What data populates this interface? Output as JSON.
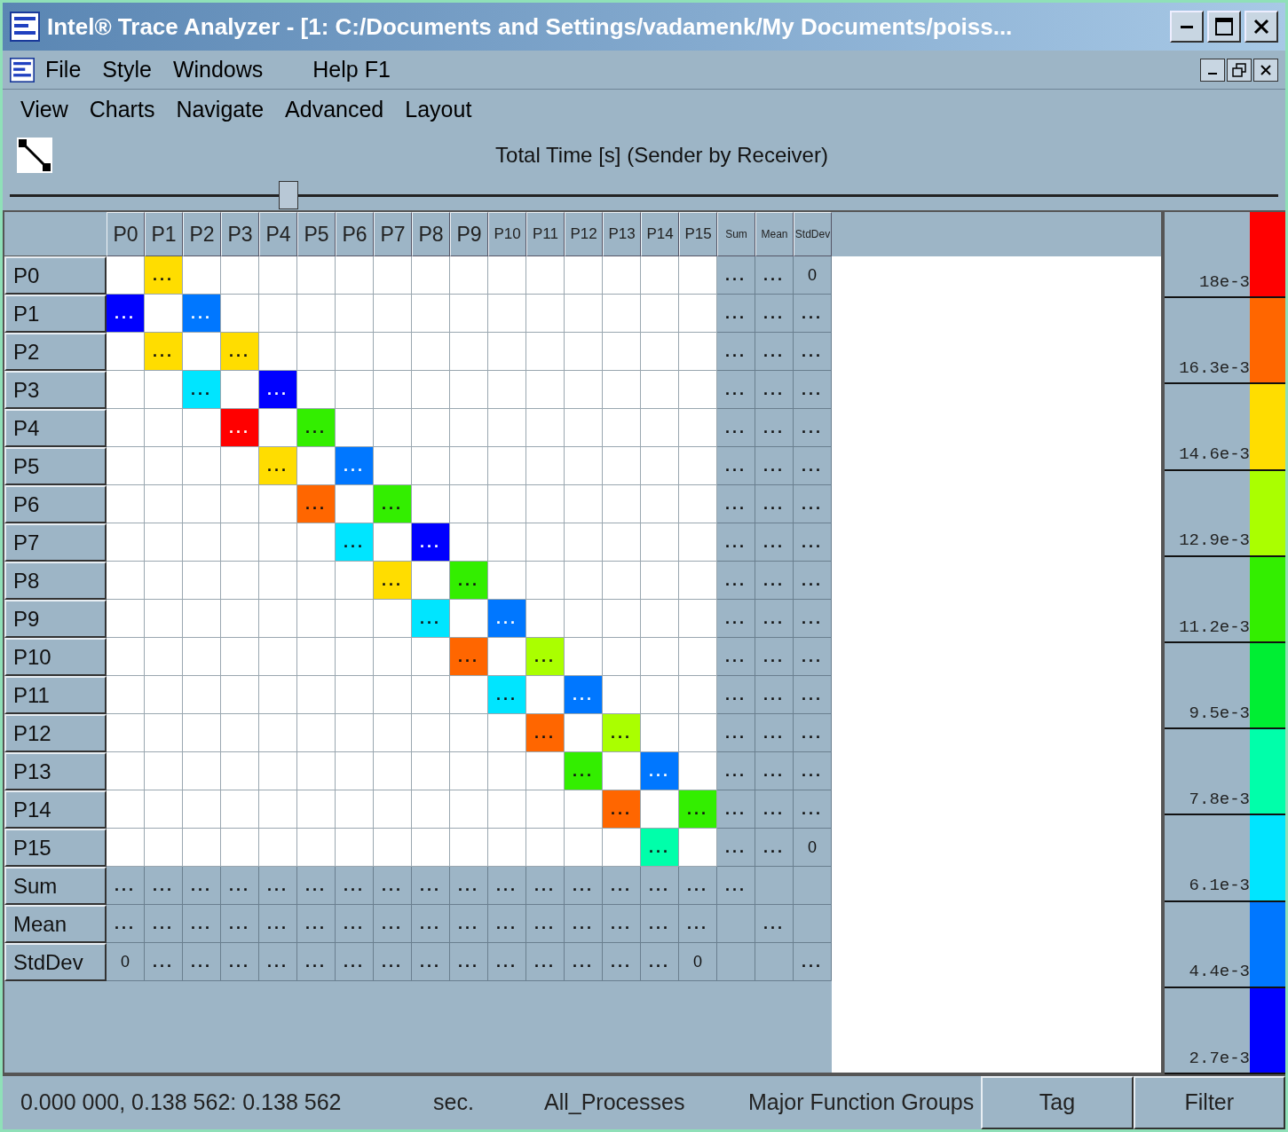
{
  "window": {
    "title": "Intel® Trace Analyzer - [1: C:/Documents and Settings/vadamenk/My Documents/poiss..."
  },
  "menu_bar": [
    "File",
    "Style",
    "Windows",
    "Help F1"
  ],
  "chart_menu": [
    "View",
    "Charts",
    "Navigate",
    "Advanced",
    "Layout"
  ],
  "chart_title": "Total Time [s] (Sender by Receiver)",
  "slider": {
    "level": 0.22
  },
  "matrix": {
    "columns": [
      {
        "label": "P0",
        "kind": "process"
      },
      {
        "label": "P1",
        "kind": "process"
      },
      {
        "label": "P2",
        "kind": "process"
      },
      {
        "label": "P3",
        "kind": "process"
      },
      {
        "label": "P4",
        "kind": "process"
      },
      {
        "label": "P5",
        "kind": "process"
      },
      {
        "label": "P6",
        "kind": "process"
      },
      {
        "label": "P7",
        "kind": "process"
      },
      {
        "label": "P8",
        "kind": "process"
      },
      {
        "label": "P9",
        "kind": "process"
      },
      {
        "label": "P10",
        "kind": "process"
      },
      {
        "label": "P11",
        "kind": "process"
      },
      {
        "label": "P12",
        "kind": "process"
      },
      {
        "label": "P13",
        "kind": "process"
      },
      {
        "label": "P14",
        "kind": "process"
      },
      {
        "label": "P15",
        "kind": "process"
      },
      {
        "label": "Sum",
        "kind": "statistic"
      },
      {
        "label": "Mean",
        "kind": "statistic"
      },
      {
        "label": "StdDev",
        "kind": "statistic"
      }
    ],
    "rows": [
      {
        "label": "P0",
        "kind": "process",
        "cells": [
          {},
          {
            "text": "...",
            "color": "#ffdd00"
          },
          {},
          {},
          {},
          {},
          {},
          {},
          {},
          {},
          {},
          {},
          {},
          {},
          {},
          {},
          {
            "text": "..."
          },
          {
            "text": "..."
          },
          {
            "text": "0"
          }
        ]
      },
      {
        "label": "P1",
        "kind": "process",
        "cells": [
          {
            "text": "...",
            "color": "#0000ff"
          },
          {},
          {
            "text": "...",
            "color": "#0077ff"
          },
          {},
          {},
          {},
          {},
          {},
          {},
          {},
          {},
          {},
          {},
          {},
          {},
          {},
          {
            "text": "..."
          },
          {
            "text": "..."
          },
          {
            "text": "..."
          }
        ]
      },
      {
        "label": "P2",
        "kind": "process",
        "cells": [
          {},
          {
            "text": "...",
            "color": "#ffdd00"
          },
          {},
          {
            "text": "...",
            "color": "#ffdd00"
          },
          {},
          {},
          {},
          {},
          {},
          {},
          {},
          {},
          {},
          {},
          {},
          {},
          {
            "text": "..."
          },
          {
            "text": "..."
          },
          {
            "text": "..."
          }
        ]
      },
      {
        "label": "P3",
        "kind": "process",
        "cells": [
          {},
          {},
          {
            "text": "...",
            "color": "#00e5ff"
          },
          {},
          {
            "text": "...",
            "color": "#0000ff"
          },
          {},
          {},
          {},
          {},
          {},
          {},
          {},
          {},
          {},
          {},
          {},
          {
            "text": "..."
          },
          {
            "text": "..."
          },
          {
            "text": "..."
          }
        ]
      },
      {
        "label": "P4",
        "kind": "process",
        "cells": [
          {},
          {},
          {},
          {
            "text": "...",
            "color": "#ff0000"
          },
          {},
          {
            "text": "...",
            "color": "#33ee00"
          },
          {},
          {},
          {},
          {},
          {},
          {},
          {},
          {},
          {},
          {},
          {
            "text": "..."
          },
          {
            "text": "..."
          },
          {
            "text": "..."
          }
        ]
      },
      {
        "label": "P5",
        "kind": "process",
        "cells": [
          {},
          {},
          {},
          {},
          {
            "text": "...",
            "color": "#ffdd00"
          },
          {},
          {
            "text": "...",
            "color": "#0077ff"
          },
          {},
          {},
          {},
          {},
          {},
          {},
          {},
          {},
          {},
          {
            "text": "..."
          },
          {
            "text": "..."
          },
          {
            "text": "..."
          }
        ]
      },
      {
        "label": "P6",
        "kind": "process",
        "cells": [
          {},
          {},
          {},
          {},
          {},
          {
            "text": "...",
            "color": "#ff6600"
          },
          {},
          {
            "text": "...",
            "color": "#33ee00"
          },
          {},
          {},
          {},
          {},
          {},
          {},
          {},
          {},
          {
            "text": "..."
          },
          {
            "text": "..."
          },
          {
            "text": "..."
          }
        ]
      },
      {
        "label": "P7",
        "kind": "process",
        "cells": [
          {},
          {},
          {},
          {},
          {},
          {},
          {
            "text": "...",
            "color": "#00e5ff"
          },
          {},
          {
            "text": "...",
            "color": "#0000ff"
          },
          {},
          {},
          {},
          {},
          {},
          {},
          {},
          {
            "text": "..."
          },
          {
            "text": "..."
          },
          {
            "text": "..."
          }
        ]
      },
      {
        "label": "P8",
        "kind": "process",
        "cells": [
          {},
          {},
          {},
          {},
          {},
          {},
          {},
          {
            "text": "...",
            "color": "#ffdd00"
          },
          {},
          {
            "text": "...",
            "color": "#33ee00"
          },
          {},
          {},
          {},
          {},
          {},
          {},
          {
            "text": "..."
          },
          {
            "text": "..."
          },
          {
            "text": "..."
          }
        ]
      },
      {
        "label": "P9",
        "kind": "process",
        "cells": [
          {},
          {},
          {},
          {},
          {},
          {},
          {},
          {},
          {
            "text": "...",
            "color": "#00e5ff"
          },
          {},
          {
            "text": "...",
            "color": "#0077ff"
          },
          {},
          {},
          {},
          {},
          {},
          {
            "text": "..."
          },
          {
            "text": "..."
          },
          {
            "text": "..."
          }
        ]
      },
      {
        "label": "P10",
        "kind": "process",
        "cells": [
          {},
          {},
          {},
          {},
          {},
          {},
          {},
          {},
          {},
          {
            "text": "...",
            "color": "#ff6600"
          },
          {},
          {
            "text": "...",
            "color": "#aaff00"
          },
          {},
          {},
          {},
          {},
          {
            "text": "..."
          },
          {
            "text": "..."
          },
          {
            "text": "..."
          }
        ]
      },
      {
        "label": "P11",
        "kind": "process",
        "cells": [
          {},
          {},
          {},
          {},
          {},
          {},
          {},
          {},
          {},
          {},
          {
            "text": "...",
            "color": "#00e5ff"
          },
          {},
          {
            "text": "...",
            "color": "#0077ff"
          },
          {},
          {},
          {},
          {
            "text": "..."
          },
          {
            "text": "..."
          },
          {
            "text": "..."
          }
        ]
      },
      {
        "label": "P12",
        "kind": "process",
        "cells": [
          {},
          {},
          {},
          {},
          {},
          {},
          {},
          {},
          {},
          {},
          {},
          {
            "text": "...",
            "color": "#ff6600"
          },
          {},
          {
            "text": "...",
            "color": "#aaff00"
          },
          {},
          {},
          {
            "text": "..."
          },
          {
            "text": "..."
          },
          {
            "text": "..."
          }
        ]
      },
      {
        "label": "P13",
        "kind": "process",
        "cells": [
          {},
          {},
          {},
          {},
          {},
          {},
          {},
          {},
          {},
          {},
          {},
          {},
          {
            "text": "...",
            "color": "#33ee00"
          },
          {},
          {
            "text": "...",
            "color": "#0077ff"
          },
          {},
          {
            "text": "..."
          },
          {
            "text": "..."
          },
          {
            "text": "..."
          }
        ]
      },
      {
        "label": "P14",
        "kind": "process",
        "cells": [
          {},
          {},
          {},
          {},
          {},
          {},
          {},
          {},
          {},
          {},
          {},
          {},
          {},
          {
            "text": "...",
            "color": "#ff6600"
          },
          {},
          {
            "text": "...",
            "color": "#33ee00"
          },
          {
            "text": "..."
          },
          {
            "text": "..."
          },
          {
            "text": "..."
          }
        ]
      },
      {
        "label": "P15",
        "kind": "process",
        "cells": [
          {},
          {},
          {},
          {},
          {},
          {},
          {},
          {},
          {},
          {},
          {},
          {},
          {},
          {},
          {
            "text": "...",
            "color": "#00ffaa"
          },
          {},
          {
            "text": "..."
          },
          {
            "text": "..."
          },
          {
            "text": "0"
          }
        ]
      },
      {
        "label": "Sum",
        "kind": "statistic",
        "cells": [
          {
            "text": "..."
          },
          {
            "text": "..."
          },
          {
            "text": "..."
          },
          {
            "text": "..."
          },
          {
            "text": "..."
          },
          {
            "text": "..."
          },
          {
            "text": "..."
          },
          {
            "text": "..."
          },
          {
            "text": "..."
          },
          {
            "text": "..."
          },
          {
            "text": "..."
          },
          {
            "text": "..."
          },
          {
            "text": "..."
          },
          {
            "text": "..."
          },
          {
            "text": "..."
          },
          {
            "text": "..."
          },
          {
            "text": "..."
          },
          {},
          {}
        ]
      },
      {
        "label": "Mean",
        "kind": "statistic",
        "cells": [
          {
            "text": "..."
          },
          {
            "text": "..."
          },
          {
            "text": "..."
          },
          {
            "text": "..."
          },
          {
            "text": "..."
          },
          {
            "text": "..."
          },
          {
            "text": "..."
          },
          {
            "text": "..."
          },
          {
            "text": "..."
          },
          {
            "text": "..."
          },
          {
            "text": "..."
          },
          {
            "text": "..."
          },
          {
            "text": "..."
          },
          {
            "text": "..."
          },
          {
            "text": "..."
          },
          {
            "text": "..."
          },
          {},
          {
            "text": "..."
          },
          {}
        ]
      },
      {
        "label": "StdDev",
        "kind": "statistic",
        "cells": [
          {
            "text": "0"
          },
          {
            "text": "..."
          },
          {
            "text": "..."
          },
          {
            "text": "..."
          },
          {
            "text": "..."
          },
          {
            "text": "..."
          },
          {
            "text": "..."
          },
          {
            "text": "..."
          },
          {
            "text": "..."
          },
          {
            "text": "..."
          },
          {
            "text": "..."
          },
          {
            "text": "..."
          },
          {
            "text": "..."
          },
          {
            "text": "..."
          },
          {
            "text": "..."
          },
          {
            "text": "0"
          },
          {},
          {},
          {
            "text": "..."
          }
        ]
      }
    ]
  },
  "legend": [
    {
      "label": "18e-3",
      "color": "#ff0000"
    },
    {
      "label": "16.3e-3",
      "color": "#ff6600"
    },
    {
      "label": "14.6e-3",
      "color": "#ffdd00"
    },
    {
      "label": "12.9e-3",
      "color": "#aaff00"
    },
    {
      "label": "11.2e-3",
      "color": "#33ee00"
    },
    {
      "label": "9.5e-3",
      "color": "#00ee33"
    },
    {
      "label": "7.8e-3",
      "color": "#00ffaa"
    },
    {
      "label": "6.1e-3",
      "color": "#00e5ff"
    },
    {
      "label": "4.4e-3",
      "color": "#0077ff"
    },
    {
      "label": "2.7e-3",
      "color": "#0000ff"
    }
  ],
  "status_bar": {
    "range": "0.000 000, 0.138 562: 0.138 562",
    "unit": "sec.",
    "processes": "All_Processes",
    "groups": "Major Function Groups",
    "buttons": [
      "Tag",
      "Filter"
    ]
  }
}
